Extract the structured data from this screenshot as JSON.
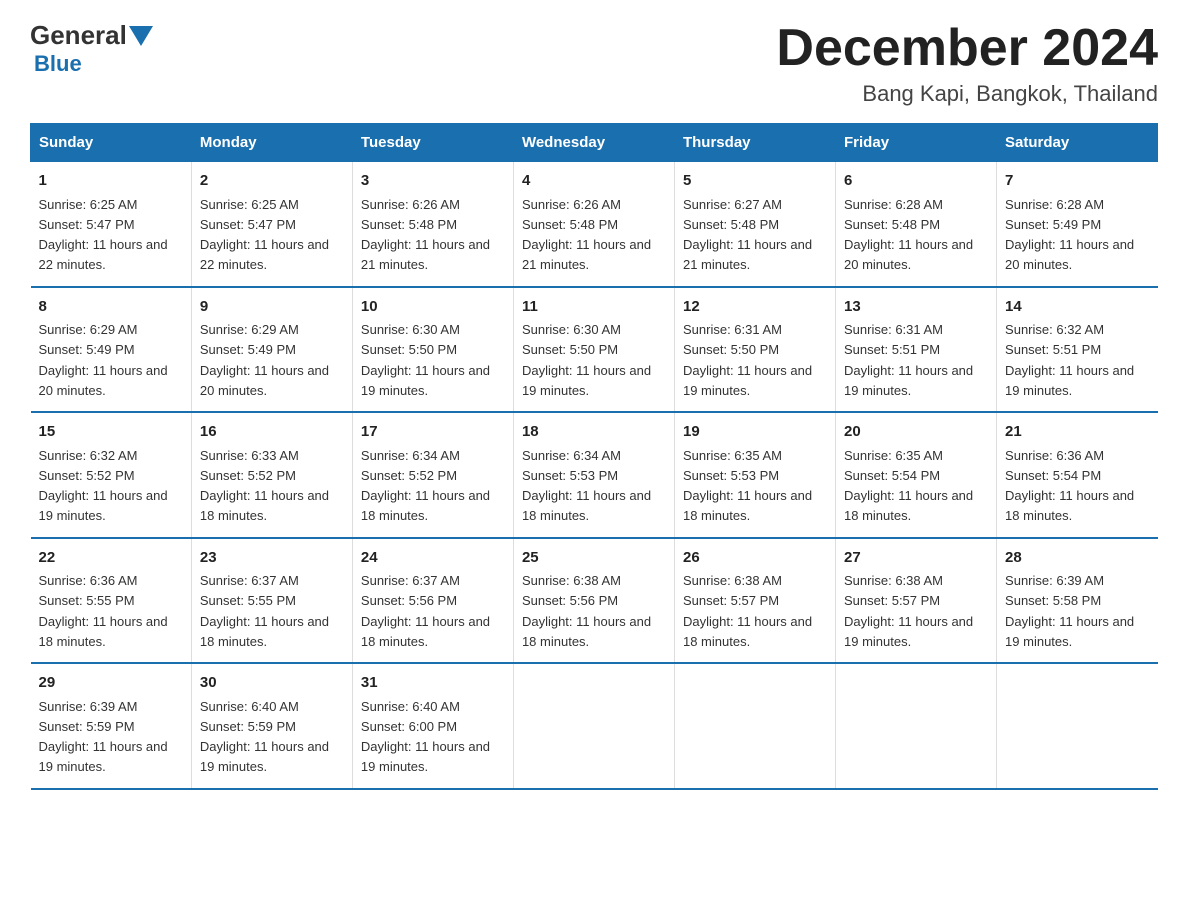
{
  "header": {
    "logo_general": "General",
    "logo_blue": "Blue",
    "month_title": "December 2024",
    "location": "Bang Kapi, Bangkok, Thailand"
  },
  "weekdays": [
    "Sunday",
    "Monday",
    "Tuesday",
    "Wednesday",
    "Thursday",
    "Friday",
    "Saturday"
  ],
  "weeks": [
    [
      {
        "day": "1",
        "sunrise": "6:25 AM",
        "sunset": "5:47 PM",
        "daylight": "11 hours and 22 minutes."
      },
      {
        "day": "2",
        "sunrise": "6:25 AM",
        "sunset": "5:47 PM",
        "daylight": "11 hours and 22 minutes."
      },
      {
        "day": "3",
        "sunrise": "6:26 AM",
        "sunset": "5:48 PM",
        "daylight": "11 hours and 21 minutes."
      },
      {
        "day": "4",
        "sunrise": "6:26 AM",
        "sunset": "5:48 PM",
        "daylight": "11 hours and 21 minutes."
      },
      {
        "day": "5",
        "sunrise": "6:27 AM",
        "sunset": "5:48 PM",
        "daylight": "11 hours and 21 minutes."
      },
      {
        "day": "6",
        "sunrise": "6:28 AM",
        "sunset": "5:48 PM",
        "daylight": "11 hours and 20 minutes."
      },
      {
        "day": "7",
        "sunrise": "6:28 AM",
        "sunset": "5:49 PM",
        "daylight": "11 hours and 20 minutes."
      }
    ],
    [
      {
        "day": "8",
        "sunrise": "6:29 AM",
        "sunset": "5:49 PM",
        "daylight": "11 hours and 20 minutes."
      },
      {
        "day": "9",
        "sunrise": "6:29 AM",
        "sunset": "5:49 PM",
        "daylight": "11 hours and 20 minutes."
      },
      {
        "day": "10",
        "sunrise": "6:30 AM",
        "sunset": "5:50 PM",
        "daylight": "11 hours and 19 minutes."
      },
      {
        "day": "11",
        "sunrise": "6:30 AM",
        "sunset": "5:50 PM",
        "daylight": "11 hours and 19 minutes."
      },
      {
        "day": "12",
        "sunrise": "6:31 AM",
        "sunset": "5:50 PM",
        "daylight": "11 hours and 19 minutes."
      },
      {
        "day": "13",
        "sunrise": "6:31 AM",
        "sunset": "5:51 PM",
        "daylight": "11 hours and 19 minutes."
      },
      {
        "day": "14",
        "sunrise": "6:32 AM",
        "sunset": "5:51 PM",
        "daylight": "11 hours and 19 minutes."
      }
    ],
    [
      {
        "day": "15",
        "sunrise": "6:32 AM",
        "sunset": "5:52 PM",
        "daylight": "11 hours and 19 minutes."
      },
      {
        "day": "16",
        "sunrise": "6:33 AM",
        "sunset": "5:52 PM",
        "daylight": "11 hours and 18 minutes."
      },
      {
        "day": "17",
        "sunrise": "6:34 AM",
        "sunset": "5:52 PM",
        "daylight": "11 hours and 18 minutes."
      },
      {
        "day": "18",
        "sunrise": "6:34 AM",
        "sunset": "5:53 PM",
        "daylight": "11 hours and 18 minutes."
      },
      {
        "day": "19",
        "sunrise": "6:35 AM",
        "sunset": "5:53 PM",
        "daylight": "11 hours and 18 minutes."
      },
      {
        "day": "20",
        "sunrise": "6:35 AM",
        "sunset": "5:54 PM",
        "daylight": "11 hours and 18 minutes."
      },
      {
        "day": "21",
        "sunrise": "6:36 AM",
        "sunset": "5:54 PM",
        "daylight": "11 hours and 18 minutes."
      }
    ],
    [
      {
        "day": "22",
        "sunrise": "6:36 AM",
        "sunset": "5:55 PM",
        "daylight": "11 hours and 18 minutes."
      },
      {
        "day": "23",
        "sunrise": "6:37 AM",
        "sunset": "5:55 PM",
        "daylight": "11 hours and 18 minutes."
      },
      {
        "day": "24",
        "sunrise": "6:37 AM",
        "sunset": "5:56 PM",
        "daylight": "11 hours and 18 minutes."
      },
      {
        "day": "25",
        "sunrise": "6:38 AM",
        "sunset": "5:56 PM",
        "daylight": "11 hours and 18 minutes."
      },
      {
        "day": "26",
        "sunrise": "6:38 AM",
        "sunset": "5:57 PM",
        "daylight": "11 hours and 18 minutes."
      },
      {
        "day": "27",
        "sunrise": "6:38 AM",
        "sunset": "5:57 PM",
        "daylight": "11 hours and 19 minutes."
      },
      {
        "day": "28",
        "sunrise": "6:39 AM",
        "sunset": "5:58 PM",
        "daylight": "11 hours and 19 minutes."
      }
    ],
    [
      {
        "day": "29",
        "sunrise": "6:39 AM",
        "sunset": "5:59 PM",
        "daylight": "11 hours and 19 minutes."
      },
      {
        "day": "30",
        "sunrise": "6:40 AM",
        "sunset": "5:59 PM",
        "daylight": "11 hours and 19 minutes."
      },
      {
        "day": "31",
        "sunrise": "6:40 AM",
        "sunset": "6:00 PM",
        "daylight": "11 hours and 19 minutes."
      },
      null,
      null,
      null,
      null
    ]
  ],
  "labels": {
    "sunrise_prefix": "Sunrise: ",
    "sunset_prefix": "Sunset: ",
    "daylight_prefix": "Daylight: "
  }
}
